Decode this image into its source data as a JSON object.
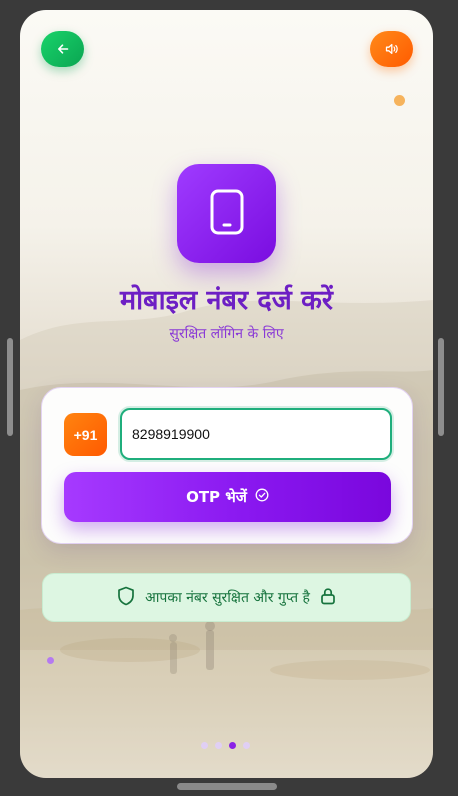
{
  "header": {
    "back_icon": "arrow-left-icon",
    "sound_icon": "speaker-icon"
  },
  "hero": {
    "icon": "smartphone-icon",
    "title": "मोबाइल नंबर दर्ज करें",
    "subtitle": "सुरक्षित लॉगिन के लिए"
  },
  "form": {
    "country_code": "+91",
    "phone_value": "8298919900",
    "submit_label": "OTP भेजें",
    "submit_icon": "check-circle-icon"
  },
  "security_note": {
    "text": "आपका नंबर सुरक्षित और गुप्त है",
    "left_icon": "shield-icon",
    "right_icon": "lock-icon"
  },
  "pager": {
    "count": 4,
    "active_index": 2
  },
  "colors": {
    "primary_purple": "#8a18f0",
    "accent_orange": "#ff6a00",
    "accent_green": "#0fbf5f",
    "secure_green": "#16733d"
  }
}
